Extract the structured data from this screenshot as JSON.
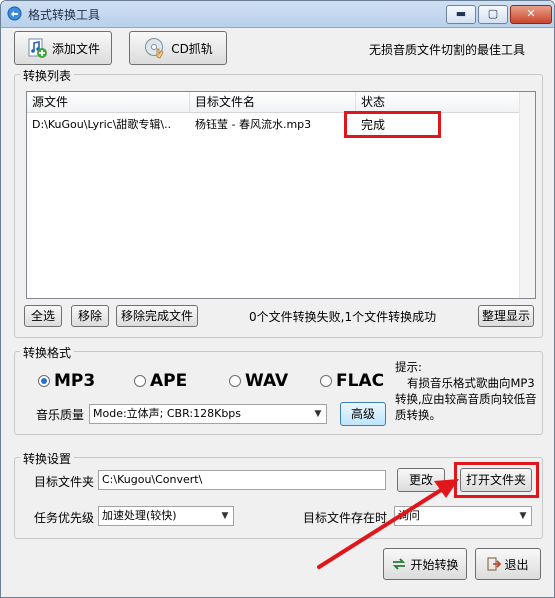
{
  "window": {
    "title": "格式转换工具",
    "min_label": "▬",
    "max_label": "▢",
    "close_label": "✕"
  },
  "toolbar": {
    "add_file_label": "添加文件",
    "cd_rip_label": "CD抓轨",
    "slogan": "无损音质文件切割的最佳工具"
  },
  "convert_list": {
    "group_label": "转换列表",
    "columns": [
      "源文件",
      "目标文件名",
      "状态"
    ],
    "rows": [
      {
        "source": "D:\\KuGou\\Lyric\\甜歌专辑\\..",
        "target": "杨钰莹 - 春风流水.mp3",
        "status": "完成"
      }
    ],
    "select_all_label": "全选",
    "remove_label": "移除",
    "remove_done_label": "移除完成文件",
    "status_text": "0个文件转换失败,1个文件转换成功",
    "tidy_label": "整理显示"
  },
  "format": {
    "group_label": "转换格式",
    "options": [
      "MP3",
      "APE",
      "WAV",
      "FLAC"
    ],
    "selected": "MP3",
    "hint_title": "提示:",
    "hint_body": "有损音乐格式歌曲向MP3转换,应由较高音质向较低音质转换。",
    "quality_label": "音乐质量",
    "quality_value": "Mode:立体声; CBR:128Kbps",
    "advanced_label": "高级"
  },
  "settings": {
    "group_label": "转换设置",
    "target_folder_label": "目标文件夹",
    "target_folder_value": "C:\\Kugou\\Convert\\",
    "change_label": "更改",
    "open_folder_label": "打开文件夹",
    "priority_label": "任务优先级",
    "priority_value": "加速处理(较快)",
    "exists_label": "目标文件存在时",
    "exists_value": "询问"
  },
  "actions": {
    "start_label": "开始转换",
    "exit_label": "退出"
  },
  "colors": {
    "highlight": "#e0161b",
    "arrow": "#e0161b",
    "radio_on": "#2a6fd1"
  }
}
